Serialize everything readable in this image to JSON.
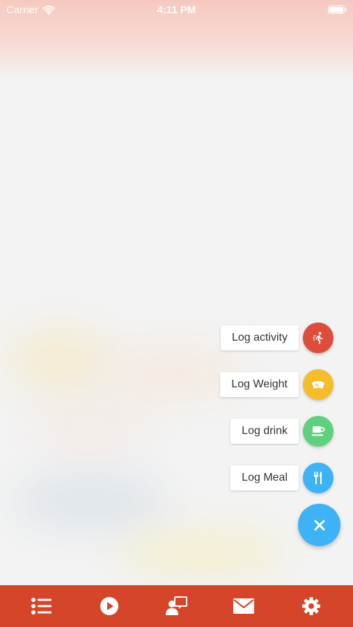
{
  "status_bar": {
    "carrier": "Carrier",
    "time": "4:11 PM",
    "icons": [
      "wifi-icon",
      "battery-icon"
    ]
  },
  "fab_menu": {
    "items": [
      {
        "label": "Log activity",
        "icon": "running-person-icon",
        "color": "#dc4d3c"
      },
      {
        "label": "Log Weight",
        "icon": "scale-icon",
        "color": "#f3bd2c"
      },
      {
        "label": "Log drink",
        "icon": "coffee-cup-icon",
        "color": "#5fd07d"
      },
      {
        "label": "Log Meal",
        "icon": "fork-knife-icon",
        "color": "#3db3f5"
      }
    ],
    "close_icon": "close-icon",
    "close_color": "#3db3f5"
  },
  "tab_bar": {
    "color": "#d4452a",
    "tabs": [
      "list-icon",
      "play-icon",
      "contact-icon",
      "mail-icon",
      "gear-icon"
    ]
  }
}
